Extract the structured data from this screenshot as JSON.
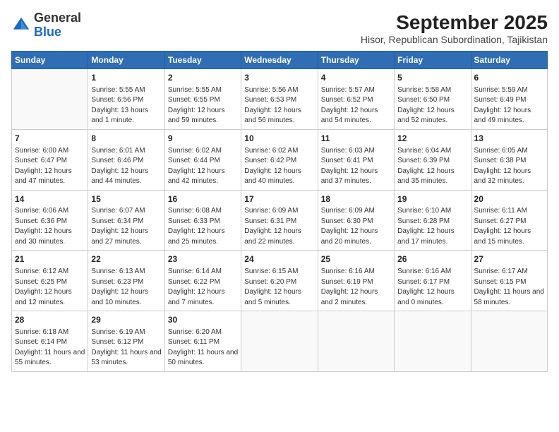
{
  "header": {
    "logo_general": "General",
    "logo_blue": "Blue",
    "title": "September 2025",
    "subtitle": "Hisor, Republican Subordination, Tajikistan"
  },
  "calendar": {
    "days_of_week": [
      "Sunday",
      "Monday",
      "Tuesday",
      "Wednesday",
      "Thursday",
      "Friday",
      "Saturday"
    ],
    "weeks": [
      [
        {
          "day": "",
          "info": ""
        },
        {
          "day": "1",
          "info": "Sunrise: 5:55 AM\nSunset: 6:56 PM\nDaylight: 13 hours and 1 minute."
        },
        {
          "day": "2",
          "info": "Sunrise: 5:55 AM\nSunset: 6:55 PM\nDaylight: 12 hours and 59 minutes."
        },
        {
          "day": "3",
          "info": "Sunrise: 5:56 AM\nSunset: 6:53 PM\nDaylight: 12 hours and 56 minutes."
        },
        {
          "day": "4",
          "info": "Sunrise: 5:57 AM\nSunset: 6:52 PM\nDaylight: 12 hours and 54 minutes."
        },
        {
          "day": "5",
          "info": "Sunrise: 5:58 AM\nSunset: 6:50 PM\nDaylight: 12 hours and 52 minutes."
        },
        {
          "day": "6",
          "info": "Sunrise: 5:59 AM\nSunset: 6:49 PM\nDaylight: 12 hours and 49 minutes."
        }
      ],
      [
        {
          "day": "7",
          "info": "Sunrise: 6:00 AM\nSunset: 6:47 PM\nDaylight: 12 hours and 47 minutes."
        },
        {
          "day": "8",
          "info": "Sunrise: 6:01 AM\nSunset: 6:46 PM\nDaylight: 12 hours and 44 minutes."
        },
        {
          "day": "9",
          "info": "Sunrise: 6:02 AM\nSunset: 6:44 PM\nDaylight: 12 hours and 42 minutes."
        },
        {
          "day": "10",
          "info": "Sunrise: 6:02 AM\nSunset: 6:42 PM\nDaylight: 12 hours and 40 minutes."
        },
        {
          "day": "11",
          "info": "Sunrise: 6:03 AM\nSunset: 6:41 PM\nDaylight: 12 hours and 37 minutes."
        },
        {
          "day": "12",
          "info": "Sunrise: 6:04 AM\nSunset: 6:39 PM\nDaylight: 12 hours and 35 minutes."
        },
        {
          "day": "13",
          "info": "Sunrise: 6:05 AM\nSunset: 6:38 PM\nDaylight: 12 hours and 32 minutes."
        }
      ],
      [
        {
          "day": "14",
          "info": "Sunrise: 6:06 AM\nSunset: 6:36 PM\nDaylight: 12 hours and 30 minutes."
        },
        {
          "day": "15",
          "info": "Sunrise: 6:07 AM\nSunset: 6:34 PM\nDaylight: 12 hours and 27 minutes."
        },
        {
          "day": "16",
          "info": "Sunrise: 6:08 AM\nSunset: 6:33 PM\nDaylight: 12 hours and 25 minutes."
        },
        {
          "day": "17",
          "info": "Sunrise: 6:09 AM\nSunset: 6:31 PM\nDaylight: 12 hours and 22 minutes."
        },
        {
          "day": "18",
          "info": "Sunrise: 6:09 AM\nSunset: 6:30 PM\nDaylight: 12 hours and 20 minutes."
        },
        {
          "day": "19",
          "info": "Sunrise: 6:10 AM\nSunset: 6:28 PM\nDaylight: 12 hours and 17 minutes."
        },
        {
          "day": "20",
          "info": "Sunrise: 6:11 AM\nSunset: 6:27 PM\nDaylight: 12 hours and 15 minutes."
        }
      ],
      [
        {
          "day": "21",
          "info": "Sunrise: 6:12 AM\nSunset: 6:25 PM\nDaylight: 12 hours and 12 minutes."
        },
        {
          "day": "22",
          "info": "Sunrise: 6:13 AM\nSunset: 6:23 PM\nDaylight: 12 hours and 10 minutes."
        },
        {
          "day": "23",
          "info": "Sunrise: 6:14 AM\nSunset: 6:22 PM\nDaylight: 12 hours and 7 minutes."
        },
        {
          "day": "24",
          "info": "Sunrise: 6:15 AM\nSunset: 6:20 PM\nDaylight: 12 hours and 5 minutes."
        },
        {
          "day": "25",
          "info": "Sunrise: 6:16 AM\nSunset: 6:19 PM\nDaylight: 12 hours and 2 minutes."
        },
        {
          "day": "26",
          "info": "Sunrise: 6:16 AM\nSunset: 6:17 PM\nDaylight: 12 hours and 0 minutes."
        },
        {
          "day": "27",
          "info": "Sunrise: 6:17 AM\nSunset: 6:15 PM\nDaylight: 11 hours and 58 minutes."
        }
      ],
      [
        {
          "day": "28",
          "info": "Sunrise: 6:18 AM\nSunset: 6:14 PM\nDaylight: 11 hours and 55 minutes."
        },
        {
          "day": "29",
          "info": "Sunrise: 6:19 AM\nSunset: 6:12 PM\nDaylight: 11 hours and 53 minutes."
        },
        {
          "day": "30",
          "info": "Sunrise: 6:20 AM\nSunset: 6:11 PM\nDaylight: 11 hours and 50 minutes."
        },
        {
          "day": "",
          "info": ""
        },
        {
          "day": "",
          "info": ""
        },
        {
          "day": "",
          "info": ""
        },
        {
          "day": "",
          "info": ""
        }
      ]
    ]
  }
}
